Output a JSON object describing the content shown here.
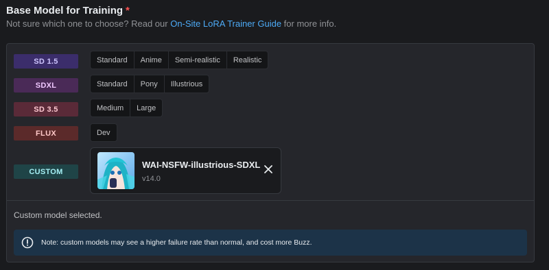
{
  "header": {
    "title": "Base Model for Training",
    "required_mark": "*",
    "subtitle_prefix": "Not sure which one to choose? Read our ",
    "guide_link": "On-Site LoRA Trainer Guide",
    "subtitle_suffix": " for more info."
  },
  "models": [
    {
      "badge": "SD 1.5",
      "badge_bg": "#3b2d6b",
      "badge_color": "#cfc6ff",
      "options": [
        "Standard",
        "Anime",
        "Semi-realistic",
        "Realistic"
      ]
    },
    {
      "badge": "SDXL",
      "badge_bg": "#4a2a57",
      "badge_color": "#f0c8ff",
      "options": [
        "Standard",
        "Pony",
        "Illustrious"
      ]
    },
    {
      "badge": "SD 3.5",
      "badge_bg": "#5a2a38",
      "badge_color": "#ffc9d2",
      "options": [
        "Medium",
        "Large"
      ]
    },
    {
      "badge": "FLUX",
      "badge_bg": "#5b2a2a",
      "badge_color": "#ffc9c9",
      "options": [
        "Dev"
      ]
    },
    {
      "badge": "CUSTOM",
      "badge_bg": "#1f4447",
      "badge_color": "#a6f0f5",
      "options": []
    }
  ],
  "custom_model": {
    "name": "WAI-NSFW-illustrious-SDXL",
    "version": "v14.0",
    "thumbnail_icon": "model-thumbnail",
    "close_icon": "close-icon"
  },
  "status": {
    "selected_text": "Custom model selected."
  },
  "alert": {
    "icon": "info-circle-icon",
    "text": "Note: custom models may see a higher failure rate than normal, and cost more Buzz."
  }
}
